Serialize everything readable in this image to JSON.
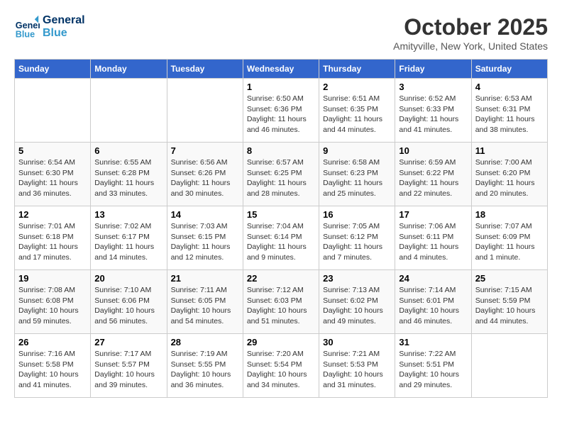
{
  "header": {
    "logo_line1": "General",
    "logo_line2": "Blue",
    "month": "October 2025",
    "location": "Amityville, New York, United States"
  },
  "days_of_week": [
    "Sunday",
    "Monday",
    "Tuesday",
    "Wednesday",
    "Thursday",
    "Friday",
    "Saturday"
  ],
  "weeks": [
    [
      {
        "num": "",
        "info": ""
      },
      {
        "num": "",
        "info": ""
      },
      {
        "num": "",
        "info": ""
      },
      {
        "num": "1",
        "info": "Sunrise: 6:50 AM\nSunset: 6:36 PM\nDaylight: 11 hours\nand 46 minutes."
      },
      {
        "num": "2",
        "info": "Sunrise: 6:51 AM\nSunset: 6:35 PM\nDaylight: 11 hours\nand 44 minutes."
      },
      {
        "num": "3",
        "info": "Sunrise: 6:52 AM\nSunset: 6:33 PM\nDaylight: 11 hours\nand 41 minutes."
      },
      {
        "num": "4",
        "info": "Sunrise: 6:53 AM\nSunset: 6:31 PM\nDaylight: 11 hours\nand 38 minutes."
      }
    ],
    [
      {
        "num": "5",
        "info": "Sunrise: 6:54 AM\nSunset: 6:30 PM\nDaylight: 11 hours\nand 36 minutes."
      },
      {
        "num": "6",
        "info": "Sunrise: 6:55 AM\nSunset: 6:28 PM\nDaylight: 11 hours\nand 33 minutes."
      },
      {
        "num": "7",
        "info": "Sunrise: 6:56 AM\nSunset: 6:26 PM\nDaylight: 11 hours\nand 30 minutes."
      },
      {
        "num": "8",
        "info": "Sunrise: 6:57 AM\nSunset: 6:25 PM\nDaylight: 11 hours\nand 28 minutes."
      },
      {
        "num": "9",
        "info": "Sunrise: 6:58 AM\nSunset: 6:23 PM\nDaylight: 11 hours\nand 25 minutes."
      },
      {
        "num": "10",
        "info": "Sunrise: 6:59 AM\nSunset: 6:22 PM\nDaylight: 11 hours\nand 22 minutes."
      },
      {
        "num": "11",
        "info": "Sunrise: 7:00 AM\nSunset: 6:20 PM\nDaylight: 11 hours\nand 20 minutes."
      }
    ],
    [
      {
        "num": "12",
        "info": "Sunrise: 7:01 AM\nSunset: 6:18 PM\nDaylight: 11 hours\nand 17 minutes."
      },
      {
        "num": "13",
        "info": "Sunrise: 7:02 AM\nSunset: 6:17 PM\nDaylight: 11 hours\nand 14 minutes."
      },
      {
        "num": "14",
        "info": "Sunrise: 7:03 AM\nSunset: 6:15 PM\nDaylight: 11 hours\nand 12 minutes."
      },
      {
        "num": "15",
        "info": "Sunrise: 7:04 AM\nSunset: 6:14 PM\nDaylight: 11 hours\nand 9 minutes."
      },
      {
        "num": "16",
        "info": "Sunrise: 7:05 AM\nSunset: 6:12 PM\nDaylight: 11 hours\nand 7 minutes."
      },
      {
        "num": "17",
        "info": "Sunrise: 7:06 AM\nSunset: 6:11 PM\nDaylight: 11 hours\nand 4 minutes."
      },
      {
        "num": "18",
        "info": "Sunrise: 7:07 AM\nSunset: 6:09 PM\nDaylight: 11 hours\nand 1 minute."
      }
    ],
    [
      {
        "num": "19",
        "info": "Sunrise: 7:08 AM\nSunset: 6:08 PM\nDaylight: 10 hours\nand 59 minutes."
      },
      {
        "num": "20",
        "info": "Sunrise: 7:10 AM\nSunset: 6:06 PM\nDaylight: 10 hours\nand 56 minutes."
      },
      {
        "num": "21",
        "info": "Sunrise: 7:11 AM\nSunset: 6:05 PM\nDaylight: 10 hours\nand 54 minutes."
      },
      {
        "num": "22",
        "info": "Sunrise: 7:12 AM\nSunset: 6:03 PM\nDaylight: 10 hours\nand 51 minutes."
      },
      {
        "num": "23",
        "info": "Sunrise: 7:13 AM\nSunset: 6:02 PM\nDaylight: 10 hours\nand 49 minutes."
      },
      {
        "num": "24",
        "info": "Sunrise: 7:14 AM\nSunset: 6:01 PM\nDaylight: 10 hours\nand 46 minutes."
      },
      {
        "num": "25",
        "info": "Sunrise: 7:15 AM\nSunset: 5:59 PM\nDaylight: 10 hours\nand 44 minutes."
      }
    ],
    [
      {
        "num": "26",
        "info": "Sunrise: 7:16 AM\nSunset: 5:58 PM\nDaylight: 10 hours\nand 41 minutes."
      },
      {
        "num": "27",
        "info": "Sunrise: 7:17 AM\nSunset: 5:57 PM\nDaylight: 10 hours\nand 39 minutes."
      },
      {
        "num": "28",
        "info": "Sunrise: 7:19 AM\nSunset: 5:55 PM\nDaylight: 10 hours\nand 36 minutes."
      },
      {
        "num": "29",
        "info": "Sunrise: 7:20 AM\nSunset: 5:54 PM\nDaylight: 10 hours\nand 34 minutes."
      },
      {
        "num": "30",
        "info": "Sunrise: 7:21 AM\nSunset: 5:53 PM\nDaylight: 10 hours\nand 31 minutes."
      },
      {
        "num": "31",
        "info": "Sunrise: 7:22 AM\nSunset: 5:51 PM\nDaylight: 10 hours\nand 29 minutes."
      },
      {
        "num": "",
        "info": ""
      }
    ]
  ]
}
